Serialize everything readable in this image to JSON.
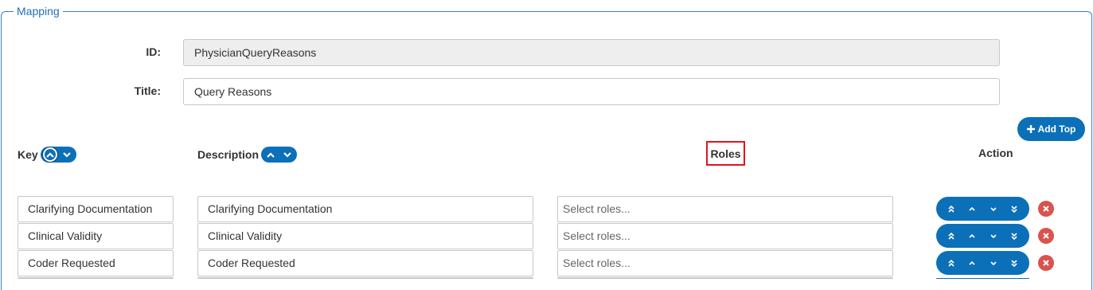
{
  "section": {
    "legend": "Mapping"
  },
  "form": {
    "id_label": "ID:",
    "id_value": "PhysicianQueryReasons",
    "title_label": "Title:",
    "title_value": "Query Reasons"
  },
  "columns": {
    "key": "Key",
    "description": "Description",
    "roles": "Roles",
    "action": "Action"
  },
  "buttons": {
    "add_top": "Add Top"
  },
  "roles_placeholder": "Select roles...",
  "rows": [
    {
      "key": "Clarifying Documentation",
      "description": "Clarifying Documentation"
    },
    {
      "key": "Clinical Validity",
      "description": "Clinical Validity"
    },
    {
      "key": "Coder Requested",
      "description": "Coder Requested"
    },
    {
      "key": "",
      "description": ""
    }
  ],
  "colors": {
    "accent": "#0b70b8",
    "legend": "#1f6fb2",
    "danger": "#d9534f",
    "highlight": "#e0141e"
  },
  "icons": [
    "chevron-up-icon",
    "chevron-down-icon",
    "plus-icon",
    "double-chevron-up-icon",
    "double-chevron-down-icon",
    "close-icon"
  ]
}
